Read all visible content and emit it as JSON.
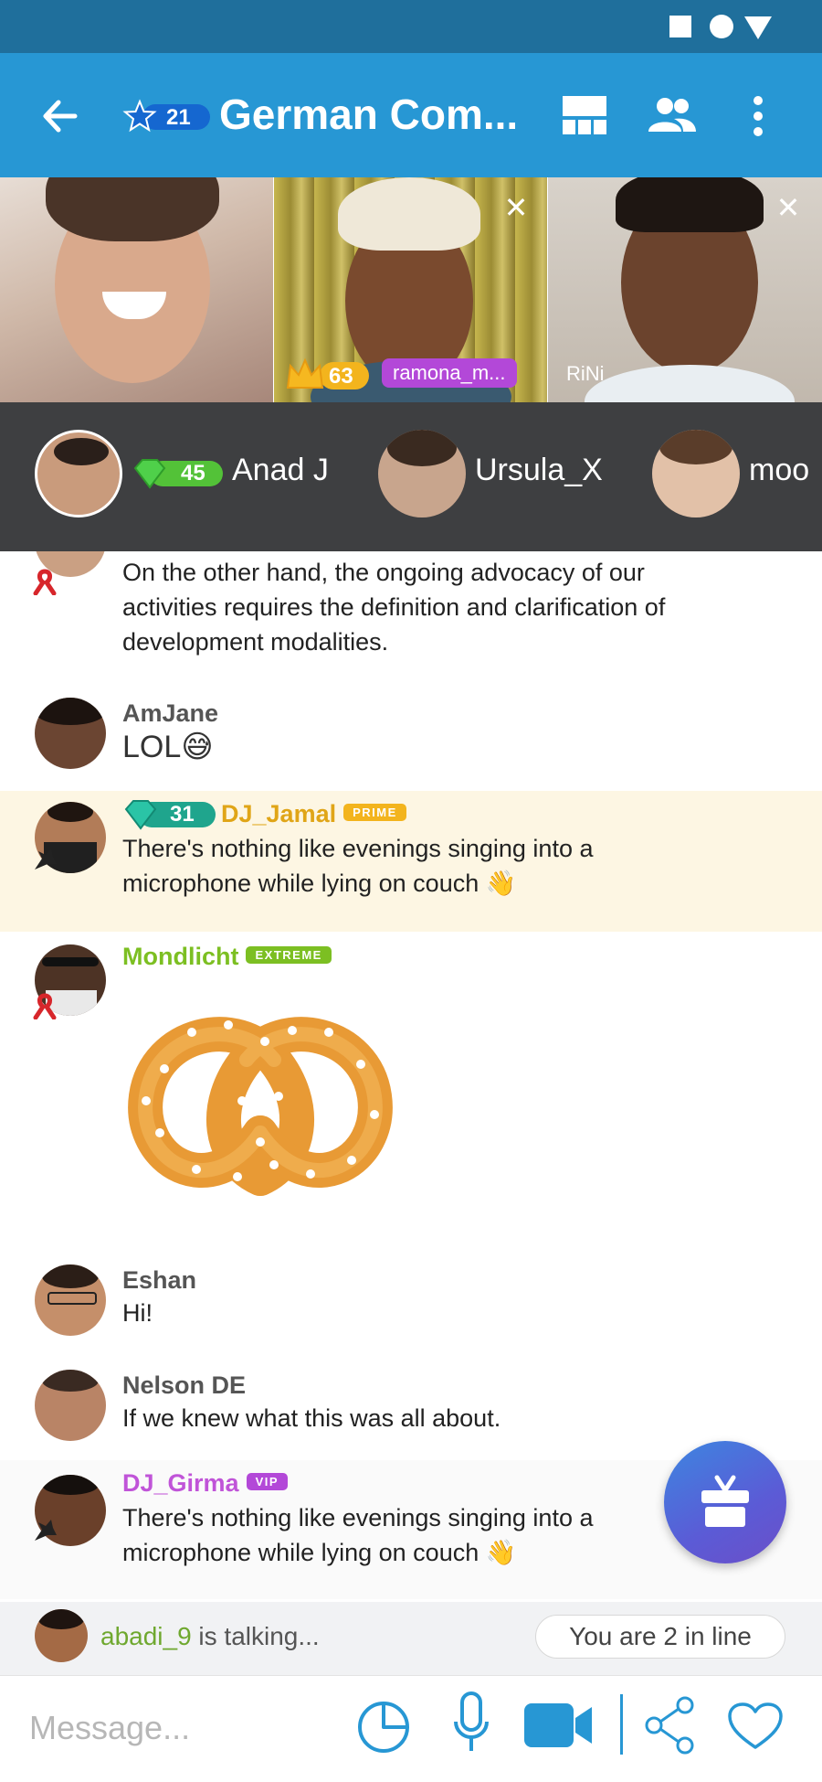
{
  "app": {
    "title": "German Com...",
    "room_level": "21"
  },
  "video_tiles": [
    {
      "name": ""
    },
    {
      "level": "63",
      "name": "ramona_m..."
    },
    {
      "name": "RiNi"
    }
  ],
  "speakers": [
    {
      "level": "45",
      "name": "Anad J"
    },
    {
      "name": "Ursula_X"
    },
    {
      "name": "moo"
    }
  ],
  "messages": [
    {
      "text": "On the other hand, the ongoing advocacy of our activities requires the definition and clarification of development modalities."
    },
    {
      "user": "AmJane",
      "text": "LOL"
    },
    {
      "user": "DJ_Jamal",
      "level": "31",
      "tag": "PRIME",
      "text": "There's nothing like evenings singing into a microphone while lying on couch"
    },
    {
      "user": "Mondlicht",
      "tag": "EXTREME",
      "sticker": "pretzel"
    },
    {
      "user": "Eshan",
      "text": "Hi!"
    },
    {
      "user": "Nelson DE",
      "text": "If we knew what this was all about."
    },
    {
      "user": "DJ_Girma",
      "tag": "VIP",
      "text": "There's nothing like evenings singing into a microphone while lying on couch"
    }
  ],
  "talk": {
    "user": "abadi_9",
    "suffix": " is talking...",
    "queue": "You are 2 in line"
  },
  "composer": {
    "placeholder": "Message..."
  },
  "colors": {
    "appbar": "#2797d4",
    "statusbar": "#1f6f9c",
    "speakers_bg": "#3e3f41",
    "prime": "#f3b41d",
    "extreme": "#7cbf22",
    "vip": "#b348d8",
    "highlight_row": "#fdf6e3"
  },
  "icons": [
    "back-arrow-icon",
    "star-icon",
    "grid-layout-icon",
    "people-icon",
    "more-vert-icon",
    "close-icon",
    "crown-icon",
    "diamond-icon",
    "ribbon-icon",
    "gift-icon",
    "sticker-icon",
    "microphone-icon",
    "video-camera-icon",
    "share-icon",
    "heart-icon"
  ]
}
